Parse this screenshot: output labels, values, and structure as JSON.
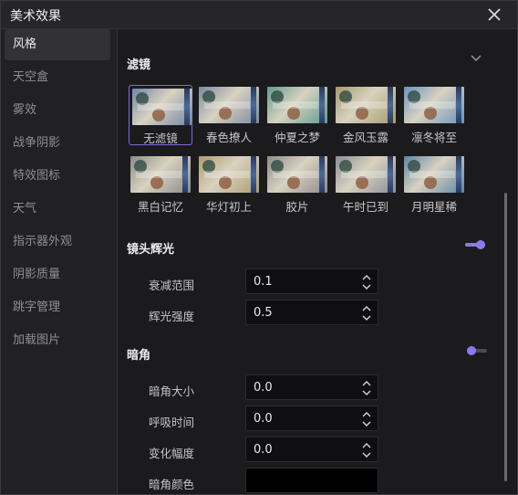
{
  "window": {
    "title": "美术效果"
  },
  "sidebar": {
    "items": [
      {
        "label": "风格",
        "active": true
      },
      {
        "label": "天空盒"
      },
      {
        "label": "雾效"
      },
      {
        "label": "战争阴影"
      },
      {
        "label": "特效图标"
      },
      {
        "label": "天气"
      },
      {
        "label": "指示器外观"
      },
      {
        "label": "阴影质量"
      },
      {
        "label": "跳字管理"
      },
      {
        "label": "加载图片"
      }
    ]
  },
  "filters": {
    "title": "滤镜",
    "items": [
      {
        "label": "无滤镜",
        "selected": true,
        "tint": "#6f86a8"
      },
      {
        "label": "春色撩人",
        "tint": "#7b8aa0"
      },
      {
        "label": "仲夏之梦",
        "tint": "#5f9a8e"
      },
      {
        "label": "金风玉露",
        "tint": "#a59a6a"
      },
      {
        "label": "凛冬将至",
        "tint": "#6a93bf"
      },
      {
        "label": "黑白记忆",
        "tint": "#8a8a8a"
      },
      {
        "label": "华灯初上",
        "tint": "#b09a70"
      },
      {
        "label": "胶片",
        "tint": "#8f8a8a"
      },
      {
        "label": "午时已到",
        "tint": "#8a8d95"
      },
      {
        "label": "月明星稀",
        "tint": "#5e86a6"
      }
    ]
  },
  "lens_flare": {
    "title": "镜头辉光",
    "enabled": true,
    "rows": [
      {
        "label": "衰减范围",
        "value": "0.1"
      },
      {
        "label": "辉光强度",
        "value": "0.5"
      }
    ]
  },
  "vignette": {
    "title": "暗角",
    "enabled": false,
    "rows": [
      {
        "label": "暗角大小",
        "value": "0.0"
      },
      {
        "label": "呼吸时间",
        "value": "0.0"
      },
      {
        "label": "变化幅度",
        "value": "0.0"
      }
    ],
    "color_label": "暗角颜色",
    "color_value": "#000000"
  },
  "colors": {
    "accent": "#8a7af0"
  },
  "icons": {
    "close": "close-icon",
    "collapse": "chevron-down-icon",
    "spinner": "up-down-arrows-icon"
  }
}
